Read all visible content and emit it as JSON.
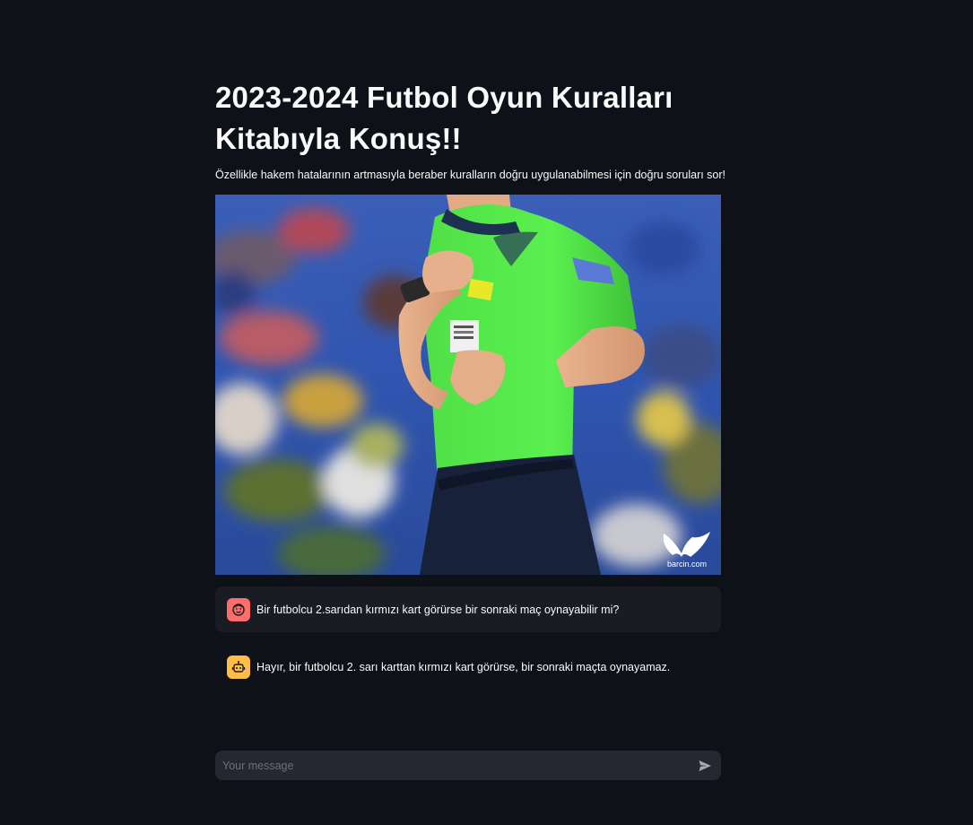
{
  "page": {
    "title": "2023-2024 Futbol Oyun Kuralları Kitabıyla Konuş!!",
    "subtitle": "Özellikle hakem hatalarının artmasıyla beraber kuralların doğru uygulanabilmesi için doğru soruları sor!"
  },
  "hero_image": {
    "watermark": "barcin.com"
  },
  "chat": {
    "messages": [
      {
        "role": "user",
        "avatar_icon": "smiley-face-icon",
        "text": "Bir futbolcu 2.sarıdan kırmızı kart görürse bir sonraki maç oynayabilir mi?"
      },
      {
        "role": "assistant",
        "avatar_icon": "robot-icon",
        "text": "Hayır, bir futbolcu 2. sarı karttan kırmızı kart görürse, bir sonraki maçta oynayamaz."
      }
    ],
    "input": {
      "placeholder": "Your message",
      "value": ""
    }
  },
  "colors": {
    "background": "#0e1117",
    "user_avatar": "#ff6c6c",
    "assistant_avatar": "#ffbd45",
    "user_message_bg": "#1a1c24",
    "input_bg": "#262730"
  }
}
